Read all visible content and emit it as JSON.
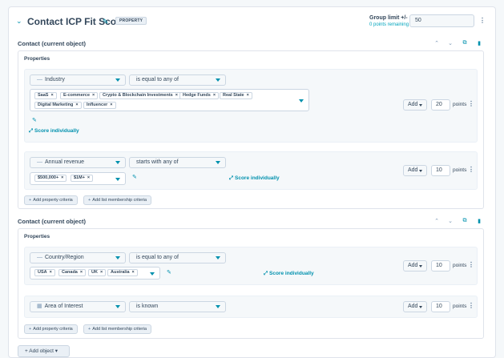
{
  "header": {
    "title": "Contact ICP Fit Score",
    "badge": "PROPERTY",
    "group_limit_label": "Group limit +/-",
    "points_remaining": "0 points remaining",
    "group_limit_value": "50"
  },
  "groups": [
    {
      "title": "Contact (current object)",
      "properties_label": "Properties",
      "criteria": [
        {
          "property": "Industry",
          "operator": "is equal to any of",
          "values": [
            "SaaS",
            "E-commerce",
            "Crypto & Blockchain Investments",
            "Hedge Funds",
            "Real State",
            "Digital Marketing",
            "Influencer"
          ],
          "score_individually": "Score individually",
          "action": "Add",
          "points": "20",
          "points_label": "points"
        },
        {
          "property": "Annual revenue",
          "operator": "starts with any of",
          "values": [
            "$500,000+",
            "$1M+"
          ],
          "score_individually": "Score individually",
          "action": "Add",
          "points": "10",
          "points_label": "points"
        }
      ],
      "add_property": "Add property criteria",
      "add_list": "Add list membership criteria"
    },
    {
      "title": "Contact (current object)",
      "properties_label": "Properties",
      "criteria": [
        {
          "property": "Country/Region",
          "operator": "is equal to any of",
          "values": [
            "USA",
            "Canada",
            "UK",
            "Australia"
          ],
          "score_individually": "Score individually",
          "action": "Add",
          "points": "10",
          "points_label": "points"
        },
        {
          "property": "Area of Interest",
          "operator": "is known",
          "action": "Add",
          "points": "10",
          "points_label": "points"
        }
      ],
      "add_property": "Add property criteria",
      "add_list": "Add list membership criteria"
    }
  ],
  "footer": {
    "add_object": "Add object"
  },
  "colors": {
    "accent": "#0091ae",
    "text": "#33475b",
    "border": "#cbd6e2",
    "panel": "#f5f8fa"
  }
}
